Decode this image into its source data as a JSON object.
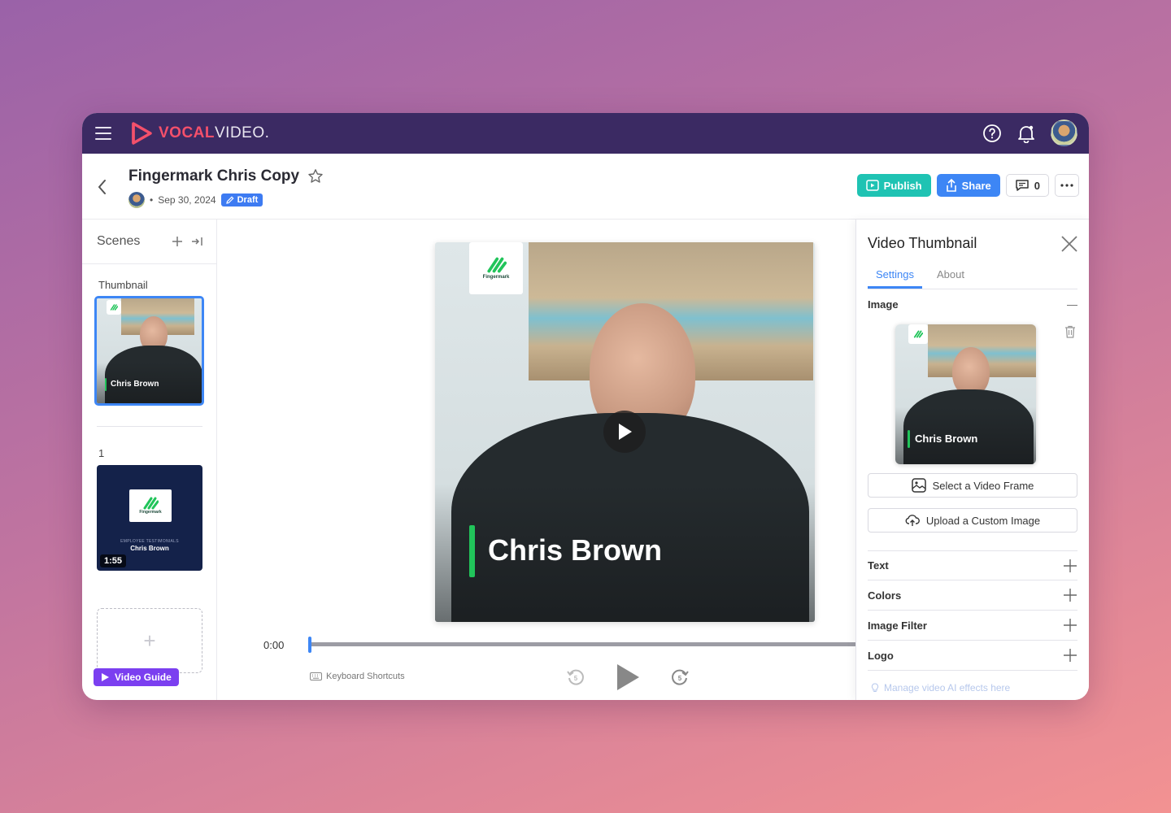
{
  "app": {
    "brand_vocal": "VOCAL",
    "brand_video": "VIDEO.",
    "colors": {
      "nav_bg": "#3b2a63",
      "accent": "#3d86f5",
      "publish": "#1fc3b3",
      "brand": "#f4506b",
      "guide": "#7b3ff0"
    }
  },
  "header": {
    "title": "Fingermark Chris Copy",
    "date": "Sep 30, 2024",
    "bullet": "•",
    "status": "Draft",
    "publish_label": "Publish",
    "share_label": "Share",
    "comments_count": "0"
  },
  "scenes": {
    "title": "Scenes",
    "thumbnail_label": "Thumbnail",
    "scene1_label": "1",
    "scene1_duration": "1:55",
    "scene1_sub": "EMPLOYEE TESTIMONIALS",
    "name": "Chris Brown",
    "logo_text": "Fingermark",
    "add_symbol": "+",
    "video_guide": "Video Guide"
  },
  "player": {
    "name_overlay": "Chris Brown",
    "logo_text": "Fingermark",
    "time": "0:00",
    "progress": 0.0,
    "keyboard_shortcuts": "Keyboard Shortcuts"
  },
  "panel": {
    "title": "Video Thumbnail",
    "tabs": [
      {
        "label": "Settings"
      },
      {
        "label": "About"
      }
    ],
    "image_label": "Image",
    "image_collapse": "—",
    "thumb_name": "Chris Brown",
    "select_frame": "Select a Video Frame",
    "upload_custom": "Upload a Custom Image",
    "sections": [
      {
        "label": "Text"
      },
      {
        "label": "Colors"
      },
      {
        "label": "Image Filter"
      },
      {
        "label": "Logo"
      }
    ],
    "manage_link": "Manage video AI effects here"
  }
}
